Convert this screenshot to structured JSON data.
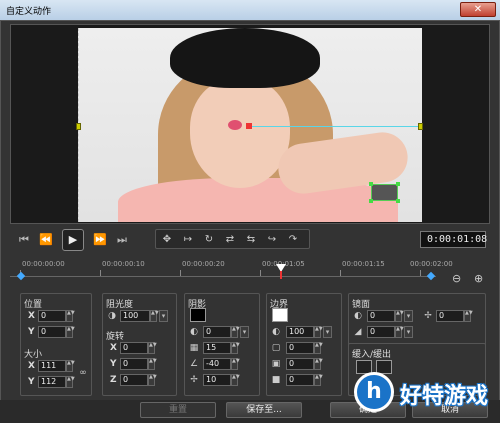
{
  "window": {
    "title": "自定义动作",
    "close_label": "✕"
  },
  "preview": {
    "playhead_marker": ""
  },
  "controls": {
    "buttons": [
      "⏮",
      "⏪",
      "▶",
      "⏩",
      "⏭"
    ],
    "keyframe_tools": [
      "✥",
      "↦",
      "↻",
      "⇄",
      "⇆",
      "↪",
      "↷"
    ],
    "timecode": "0:00:01:08"
  },
  "ruler": {
    "labels": [
      "00:00:00:00",
      "00:00:00:10",
      "00:00:00:20",
      "00:00:01:05",
      "00:00:01:15",
      "00:00:02:00"
    ],
    "zoom_out": "⊖",
    "zoom_in": "⊕"
  },
  "position": {
    "label": "位置",
    "x_label": "X",
    "x_value": "0",
    "y_label": "Y",
    "y_value": "0"
  },
  "size": {
    "label": "大小",
    "x_label": "X",
    "x_value": "111",
    "y_label": "Y",
    "y_value": "112"
  },
  "opacity": {
    "label": "阻光度",
    "value": "100"
  },
  "rotation": {
    "label": "旋转",
    "x_label": "X",
    "x_value": "0",
    "y_label": "Y",
    "y_value": "0",
    "z_label": "Z",
    "z_value": "0"
  },
  "shadow": {
    "label": "阴影",
    "values": [
      "0",
      "15",
      "-40",
      "10"
    ]
  },
  "border": {
    "label": "边界",
    "values": [
      "100",
      "0",
      "0",
      "0"
    ]
  },
  "mirror": {
    "label": "镜面",
    "values": [
      "0",
      "0"
    ],
    "side_value": "0"
  },
  "fade": {
    "label": "缓入/缓出"
  },
  "buttons": {
    "reset": "重置",
    "save_to": "保存至...",
    "ok": "确定",
    "cancel": "取消"
  },
  "watermark": {
    "circle": "h",
    "text": "好特游戏"
  }
}
